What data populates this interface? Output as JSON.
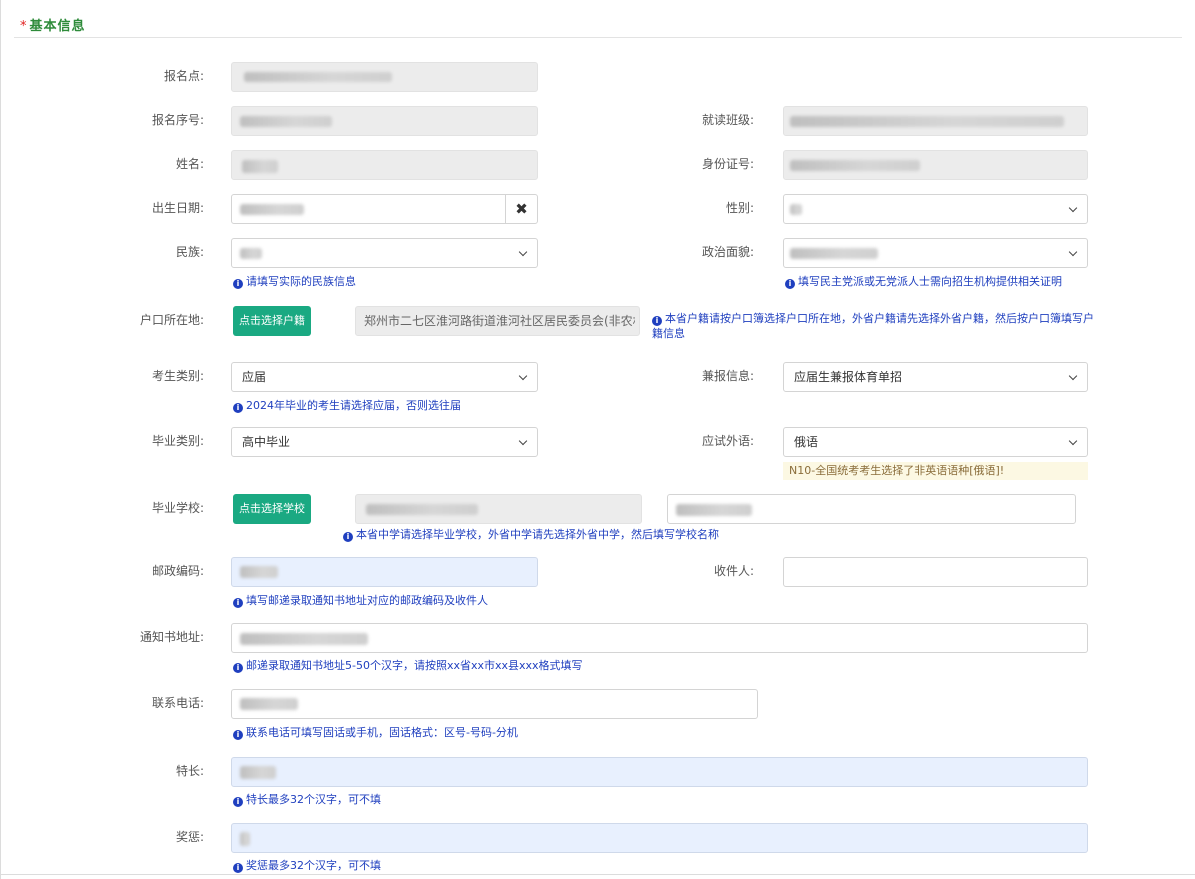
{
  "section": {
    "required_mark": "*",
    "title": "基本信息"
  },
  "labels": {
    "signup_point": "报名点:",
    "signup_no": "报名序号:",
    "class": "就读班级:",
    "name": "姓名:",
    "id_no": "身份证号:",
    "birth": "出生日期:",
    "gender": "性别:",
    "ethnicity": "民族:",
    "political": "政治面貌:",
    "household": "户口所在地:",
    "candidate_type": "考生类别:",
    "extra": "兼报信息:",
    "grad_type": "毕业类别:",
    "foreign_lang": "应试外语:",
    "school": "毕业学校:",
    "postcode": "邮政编码:",
    "recipient": "收件人:",
    "address": "通知书地址:",
    "phone": "联系电话:",
    "specialty": "特长:",
    "awards": "奖惩:"
  },
  "values": {
    "household": "郑州市二七区淮河路街道淮河社区居民委员会(非农村",
    "candidate_type": "应届",
    "extra": "应届生兼报体育单招",
    "grad_type": "高中毕业",
    "foreign_lang": "俄语"
  },
  "buttons": {
    "choose_household": "点击选择户籍",
    "choose_school": "点击选择学校",
    "clear_icon": "✖"
  },
  "hints": {
    "ethnicity": "请填写实际的民族信息",
    "political": "填写民主党派或无党派人士需向招生机构提供相关证明",
    "household": "本省户籍请按户口簿选择户口所在地，外省户籍请先选择外省户籍，然后按户口簿填写户籍信息",
    "candidate_type": "2024年毕业的考生请选择应届，否则选往届",
    "school": "本省中学请选择毕业学校，外省中学请先选择外省中学，然后填写学校名称",
    "postcode": "填写邮递录取通知书地址对应的邮政编码及收件人",
    "address": "邮递录取通知书地址5-50个汉字，请按照xx省xx市xx县xxx格式填写",
    "phone": "联系电话可填写固话或手机，固话格式：区号-号码-分机",
    "specialty": "特长最多32个汉字，可不填",
    "awards": "奖惩最多32个汉字，可不填"
  },
  "warnings": {
    "foreign_lang": "N10-全国统考考生选择了非英语语种[俄语]!"
  },
  "icons": {
    "info": "i"
  },
  "colors": {
    "title": "#2e8b3a",
    "button": "#1aa982",
    "hint": "#1f3fbf",
    "warn_bg": "#fcf8e3"
  }
}
